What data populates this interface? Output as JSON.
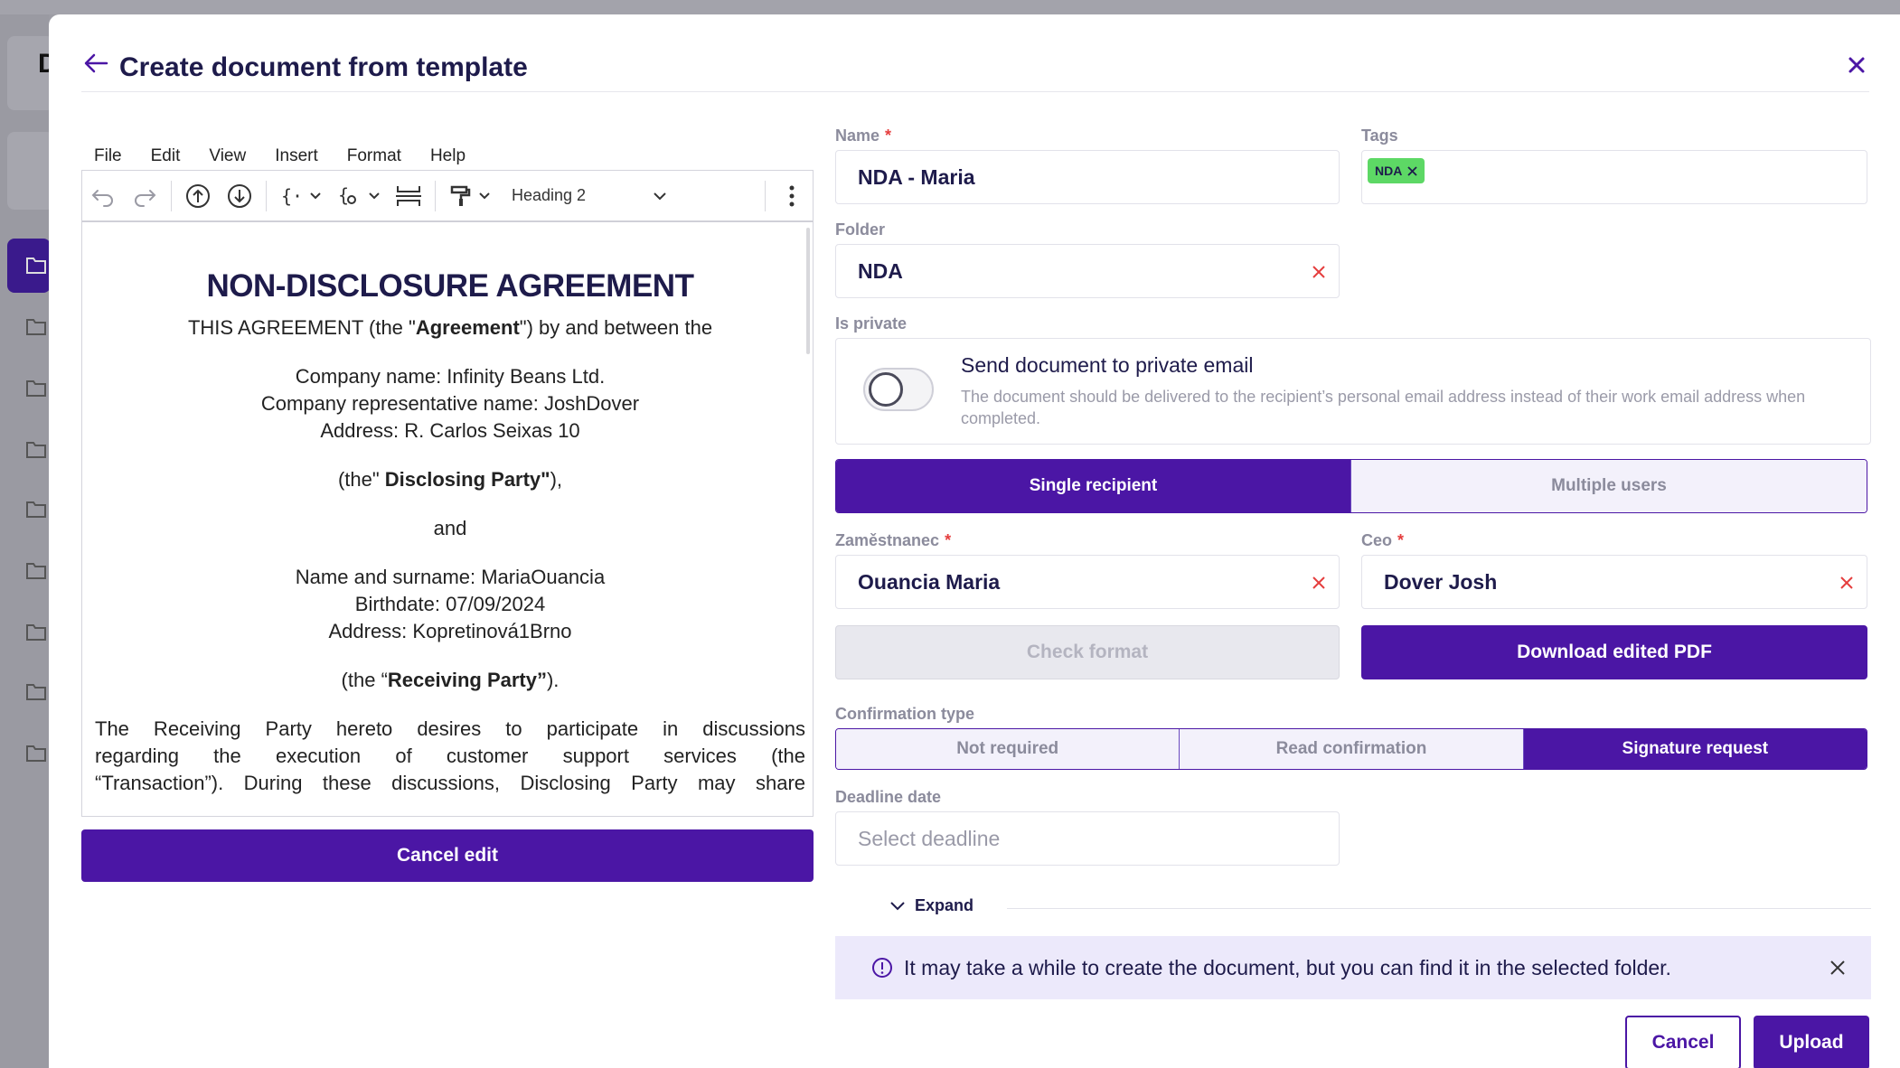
{
  "background": {
    "letter": "D"
  },
  "modal": {
    "title": "Create document from template"
  },
  "editor": {
    "menu": [
      "File",
      "Edit",
      "View",
      "Insert",
      "Format",
      "Help"
    ],
    "block_style": "Heading 2",
    "document": {
      "heading": "NON-DISCLOSURE AGREEMENT",
      "intro_pre": "THIS AGREEMENT (the \"",
      "intro_bold": "Agreement",
      "intro_post": "\") by and between the",
      "company_name": "Company name: Infinity Beans Ltd.",
      "company_rep": "Company representative name: JoshDover",
      "company_address": "Address: R. Carlos Seixas 10",
      "disclosing_pre": "(the\" ",
      "disclosing_bold": "Disclosing Party\"",
      "disclosing_post": "),",
      "and": "and",
      "person_name": "Name and surname: MariaOuancia",
      "birthdate": "Birthdate: 07/09/2024",
      "person_address": "Address: Kopretinová1Brno",
      "receiving_pre": "(the “",
      "receiving_bold": "Receiving Party”",
      "receiving_post": ").",
      "para_line1": "The Receiving Party hereto desires to participate in discussions",
      "para_line2": "regarding the execution of customer support services (the",
      "para_line3": "“Transaction”). During these discussions, Disclosing Party may share"
    },
    "cancel_edit_label": "Cancel edit"
  },
  "form": {
    "name_label": "Name",
    "name_value": "NDA - Maria",
    "tags_label": "Tags",
    "tags": [
      "NDA"
    ],
    "folder_label": "Folder",
    "folder_value": "NDA",
    "private_label": "Is private",
    "private_title": "Send document to private email",
    "private_desc": "The document should be delivered to the recipient’s personal email address instead of their work email address when completed.",
    "recipient_mode": {
      "options": [
        "Single recipient",
        "Multiple users"
      ],
      "selected": "Single recipient"
    },
    "employee_label": "Zaměstnanec",
    "employee_value": "Ouancia Maria",
    "ceo_label": "Ceo",
    "ceo_value": "Dover Josh",
    "check_format_label": "Check format",
    "download_label": "Download edited PDF",
    "confirmation_label": "Confirmation type",
    "confirmation": {
      "options": [
        "Not required",
        "Read confirmation",
        "Signature request"
      ],
      "selected": "Signature request"
    },
    "deadline_label": "Deadline date",
    "deadline_placeholder": "Select deadline",
    "expand_label": "Expand",
    "info_text": "It may take a while to create the document, but you can find it in the selected folder.",
    "cancel_label": "Cancel",
    "upload_label": "Upload"
  },
  "colors": {
    "primary": "#4b16a5",
    "required": "#e53e3e",
    "tag": "#5dd865",
    "info_bg": "#ece9fb"
  }
}
